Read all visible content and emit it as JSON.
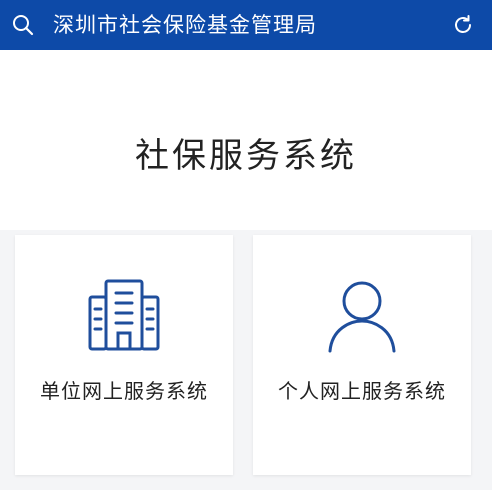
{
  "header": {
    "title": "深圳市社会保险基金管理局",
    "search_icon": "search-icon",
    "refresh_icon": "refresh-icon",
    "background_color": "#0d4aa8"
  },
  "main": {
    "title": "社保服务系统",
    "cards": [
      {
        "label": "单位网上服务系统",
        "icon": "building-icon"
      },
      {
        "label": "个人网上服务系统",
        "icon": "person-icon"
      }
    ],
    "accent_color": "#1f4e9c"
  }
}
